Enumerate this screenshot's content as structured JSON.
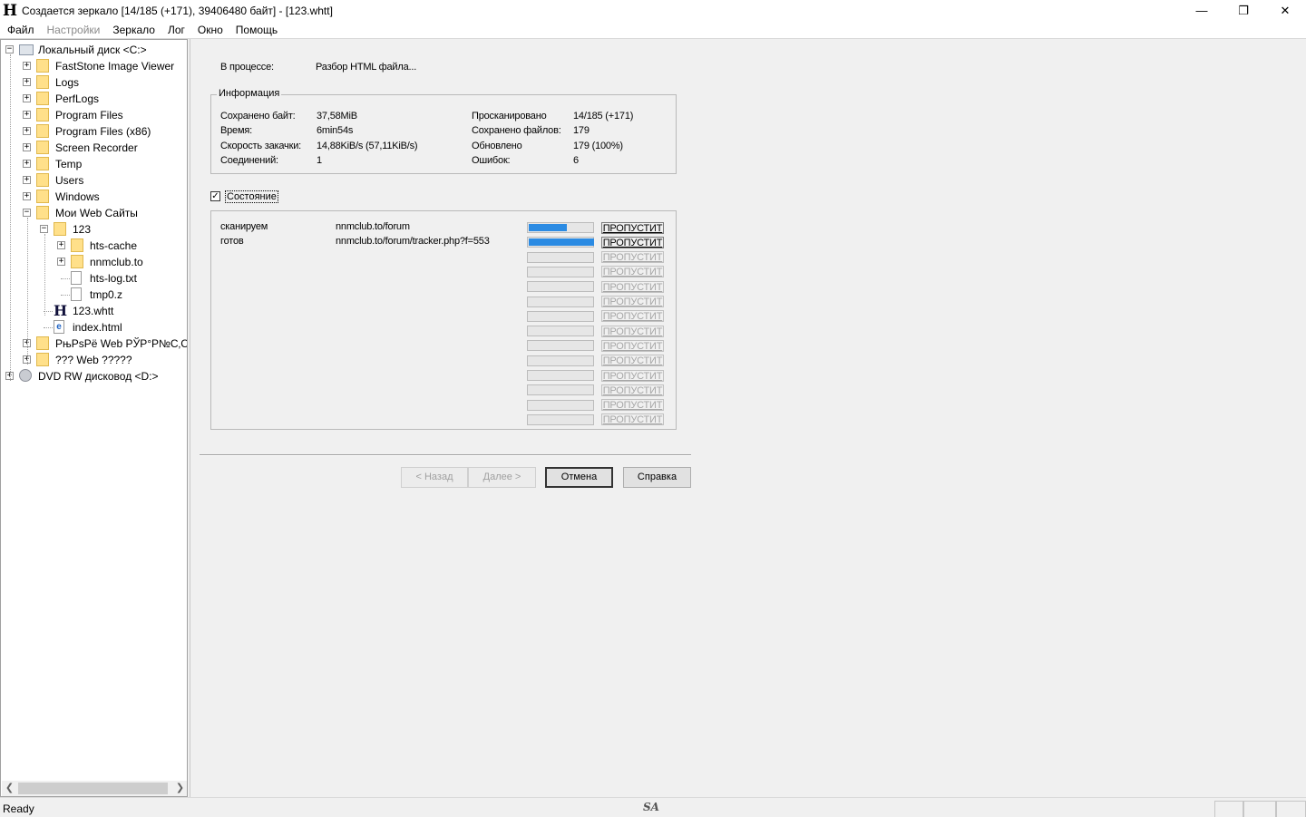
{
  "window": {
    "title": "Создается зеркало [14/185 (+171), 39406480 байт] - [123.whtt]",
    "app_icon": "H",
    "controls": {
      "minimize": "—",
      "maximize": "❐",
      "close": "✕"
    }
  },
  "menu": [
    {
      "label": "Файл",
      "disabled": false
    },
    {
      "label": "Настройки",
      "disabled": true
    },
    {
      "label": "Зеркало",
      "disabled": false
    },
    {
      "label": "Лог",
      "disabled": false
    },
    {
      "label": "Окно",
      "disabled": false
    },
    {
      "label": "Помощь",
      "disabled": false
    }
  ],
  "tree": [
    {
      "label": "Локальный диск <C:>",
      "icon": "drive-icon",
      "expander": "−"
    },
    {
      "label": "FastStone Image Viewer",
      "icon": "folder-icon",
      "expander": "+"
    },
    {
      "label": "Logs",
      "icon": "folder-icon",
      "expander": "+"
    },
    {
      "label": "PerfLogs",
      "icon": "folder-icon",
      "expander": "+"
    },
    {
      "label": "Program Files",
      "icon": "folder-icon",
      "expander": "+"
    },
    {
      "label": "Program Files (x86)",
      "icon": "folder-icon",
      "expander": "+"
    },
    {
      "label": "Screen Recorder",
      "icon": "folder-icon",
      "expander": "+"
    },
    {
      "label": "Temp",
      "icon": "folder-icon",
      "expander": "+"
    },
    {
      "label": "Users",
      "icon": "folder-icon",
      "expander": "+"
    },
    {
      "label": "Windows",
      "icon": "folder-icon",
      "expander": "+"
    },
    {
      "label": "Мои Web Сайты",
      "icon": "folder-icon",
      "expander": "−"
    },
    {
      "label": "123",
      "icon": "folder-icon",
      "expander": "−"
    },
    {
      "label": "hts-cache",
      "icon": "folder-icon",
      "expander": "+"
    },
    {
      "label": "nnmclub.to",
      "icon": "folder-icon",
      "expander": "+"
    },
    {
      "label": "hts-log.txt",
      "icon": "file-icon",
      "expander": ""
    },
    {
      "label": "tmp0.z",
      "icon": "file-icon",
      "expander": ""
    },
    {
      "label": "123.whtt",
      "icon": "whtt-icon",
      "expander": ""
    },
    {
      "label": "index.html",
      "icon": "html-icon",
      "expander": ""
    },
    {
      "label": "РњРѕРё Web РЎР°Р№С‚С‹",
      "icon": "folder-icon",
      "expander": "+"
    },
    {
      "label": "??? Web ?????",
      "icon": "folder-icon",
      "expander": "+"
    },
    {
      "label": "DVD RW дисковод <D:>",
      "icon": "dvd-icon",
      "expander": "+"
    }
  ],
  "progress": {
    "in_process_label": "В процессе:",
    "in_process_value": "Разбор HTML файла..."
  },
  "info": {
    "caption": "Информация",
    "left": [
      {
        "label": "Сохранено байт:",
        "value": "37,58MiB"
      },
      {
        "label": "Время:",
        "value": "6min54s"
      },
      {
        "label": "Скорость закачки:",
        "value": "14,88KiB/s (57,11KiB/s)"
      },
      {
        "label": "Соединений:",
        "value": "1"
      }
    ],
    "right": [
      {
        "label": "Просканировано",
        "value": "14/185 (+171)"
      },
      {
        "label": "Сохранено файлов:",
        "value": "179"
      },
      {
        "label": "Обновлено",
        "value": "179 (100%)"
      },
      {
        "label": "Ошибок:",
        "value": "6"
      }
    ]
  },
  "state": {
    "checkbox_label": "Состояние",
    "checked": true,
    "checkmark": "✓",
    "rows": [
      {
        "status": "сканируем",
        "url": "nnmclub.to/forum",
        "progress": 0.58,
        "skip": "ПРОПУСТИТ",
        "enabled": true
      },
      {
        "status": "готов",
        "url": "nnmclub.to/forum/tracker.php?f=553",
        "progress": 1.0,
        "skip": "ПРОПУСТИТ",
        "enabled": true
      },
      {
        "status": "",
        "url": "",
        "progress": 0,
        "skip": "ПРОПУСТИТ",
        "enabled": false
      },
      {
        "status": "",
        "url": "",
        "progress": 0,
        "skip": "ПРОПУСТИТ",
        "enabled": false
      },
      {
        "status": "",
        "url": "",
        "progress": 0,
        "skip": "ПРОПУСТИТ",
        "enabled": false
      },
      {
        "status": "",
        "url": "",
        "progress": 0,
        "skip": "ПРОПУСТИТ",
        "enabled": false
      },
      {
        "status": "",
        "url": "",
        "progress": 0,
        "skip": "ПРОПУСТИТ",
        "enabled": false
      },
      {
        "status": "",
        "url": "",
        "progress": 0,
        "skip": "ПРОПУСТИТ",
        "enabled": false
      },
      {
        "status": "",
        "url": "",
        "progress": 0,
        "skip": "ПРОПУСТИТ",
        "enabled": false
      },
      {
        "status": "",
        "url": "",
        "progress": 0,
        "skip": "ПРОПУСТИТ",
        "enabled": false
      },
      {
        "status": "",
        "url": "",
        "progress": 0,
        "skip": "ПРОПУСТИТ",
        "enabled": false
      },
      {
        "status": "",
        "url": "",
        "progress": 0,
        "skip": "ПРОПУСТИТ",
        "enabled": false
      },
      {
        "status": "",
        "url": "",
        "progress": 0,
        "skip": "ПРОПУСТИТ",
        "enabled": false
      },
      {
        "status": "",
        "url": "",
        "progress": 0,
        "skip": "ПРОПУСТИТ",
        "enabled": false
      }
    ]
  },
  "buttons": {
    "back": "< Назад",
    "next": "Далее >",
    "cancel": "Отмена",
    "help": "Справка"
  },
  "statusbar": {
    "text": "Ready",
    "logo": "SA"
  },
  "colors": {
    "progress_fill": "#2b8be3",
    "folder": "#ffe08a"
  }
}
